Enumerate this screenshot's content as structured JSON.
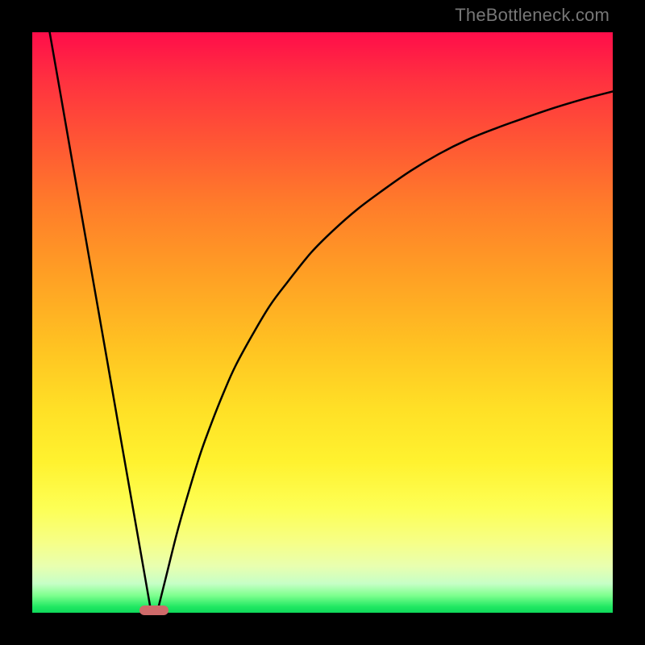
{
  "attribution": "TheBottleneck.com",
  "colors": {
    "frame": "#000000",
    "curve": "#000000",
    "marker": "#cf6a6a"
  },
  "chart_data": {
    "type": "line",
    "title": "",
    "xlabel": "",
    "ylabel": "",
    "xlim": [
      0,
      100
    ],
    "ylim": [
      0,
      100
    ],
    "grid": false,
    "legend": false,
    "annotations": [],
    "marker": {
      "x_start": 18.5,
      "x_end": 23.5,
      "y": 0
    },
    "series": [
      {
        "name": "left-segment",
        "x": [
          3,
          5,
          7,
          9,
          11,
          13,
          15,
          17,
          19,
          20.5
        ],
        "values": [
          100,
          88.6,
          77.1,
          65.7,
          54.3,
          42.9,
          31.4,
          20.0,
          8.6,
          0
        ]
      },
      {
        "name": "right-curve",
        "x": [
          21.5,
          23,
          25,
          27,
          29,
          31,
          33,
          35,
          38,
          41,
          44,
          48,
          52,
          56,
          60,
          65,
          70,
          75,
          80,
          85,
          90,
          95,
          100
        ],
        "values": [
          0,
          6,
          14,
          21,
          27.5,
          33,
          38,
          42.5,
          48,
          53,
          57,
          62,
          66,
          69.5,
          72.5,
          76,
          79,
          81.5,
          83.5,
          85.3,
          87,
          88.5,
          89.8
        ]
      }
    ]
  }
}
